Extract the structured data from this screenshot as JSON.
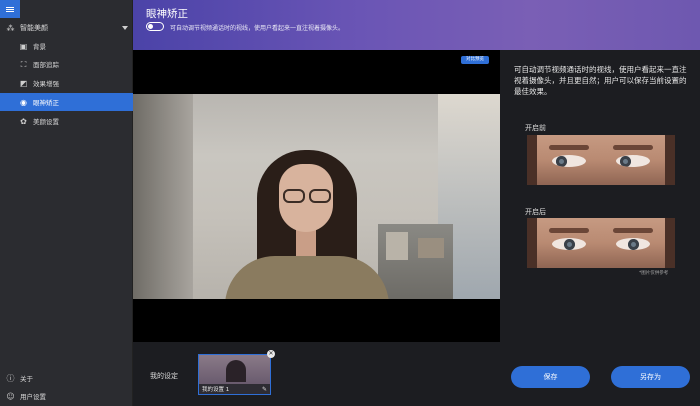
{
  "sidebar": {
    "group_label": "智能美颜",
    "items": [
      {
        "label": "背景",
        "icon": "image-icon"
      },
      {
        "label": "面部追踪",
        "icon": "face-frame-icon"
      },
      {
        "label": "效果增强",
        "icon": "enhance-icon"
      },
      {
        "label": "眼神矫正",
        "icon": "eye-icon",
        "active": true
      },
      {
        "label": "美颜设置",
        "icon": "beauty-icon"
      }
    ],
    "bottom": [
      {
        "label": "关于",
        "icon": "info-icon"
      },
      {
        "label": "用户设置",
        "icon": "user-icon"
      }
    ]
  },
  "header": {
    "title": "眼神矫正",
    "toggle_on": false,
    "description": "可自动调节视频通话时的视线，使用户看起来一直注视着摄像头。"
  },
  "preview": {
    "compare_label": "对比预览"
  },
  "presets": {
    "label": "我的设定",
    "items": [
      {
        "name": "我的设置 1"
      }
    ]
  },
  "panel": {
    "info": "可自动调节视频通话时的视线，使用户看起来一直注视着摄像头，并且更自然；用户可以保存当前设置的最佳效果。",
    "before_label": "开启前",
    "after_label": "开启后",
    "footnote": "*图片仅供参考"
  },
  "actions": {
    "save_label": "保存",
    "save_as_label": "另存为"
  },
  "colors": {
    "accent": "#2f6fd7",
    "sidebar_bg": "#2b2c30",
    "main_bg": "#1c1d21"
  }
}
